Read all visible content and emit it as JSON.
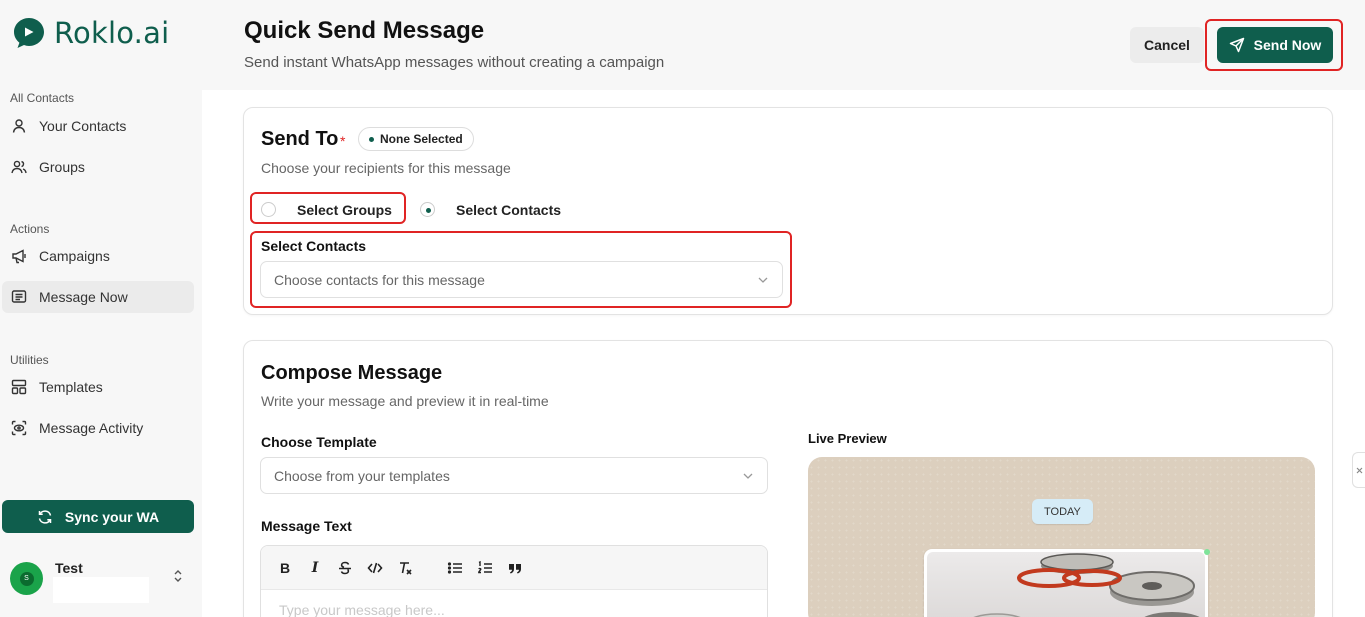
{
  "brand": {
    "name": "Roklo.ai",
    "color": "#0f5e4d"
  },
  "sidebar": {
    "sections": [
      {
        "title": "All Contacts",
        "items": [
          {
            "label": "Your Contacts",
            "icon": "user-icon"
          },
          {
            "label": "Groups",
            "icon": "users-icon"
          }
        ]
      },
      {
        "title": "Actions",
        "items": [
          {
            "label": "Campaigns",
            "icon": "megaphone-icon"
          },
          {
            "label": "Message Now",
            "icon": "message-square-icon",
            "active": true
          }
        ]
      },
      {
        "title": "Utilities",
        "items": [
          {
            "label": "Templates",
            "icon": "layout-icon"
          },
          {
            "label": "Message Activity",
            "icon": "scan-eye-icon"
          }
        ]
      }
    ],
    "sync_button": "Sync your WA",
    "user": {
      "name": "Test",
      "initial": "S"
    }
  },
  "header": {
    "title": "Quick Send Message",
    "subtitle": "Send instant WhatsApp messages without creating a campaign",
    "cancel": "Cancel",
    "send_now": "Send Now"
  },
  "send_to": {
    "title": "Send To",
    "required": "*",
    "badge": "None Selected",
    "subtitle": "Choose your recipients for this message",
    "options": [
      {
        "label": "Select Groups",
        "checked": false
      },
      {
        "label": "Select Contacts",
        "checked": true
      }
    ],
    "contacts_label": "Select Contacts",
    "contacts_placeholder": "Choose contacts for this message"
  },
  "compose": {
    "title": "Compose Message",
    "subtitle": "Write your message and preview it in real-time",
    "template_label": "Choose Template",
    "template_placeholder": "Choose from your templates",
    "message_label": "Message Text",
    "toolbar": [
      "B",
      "I",
      "S",
      "</>",
      "Tx",
      "list",
      "ordered-list",
      "quote"
    ],
    "message_placeholder": "Type your message here...",
    "preview_label": "Live Preview",
    "preview_day": "TODAY"
  },
  "colors": {
    "accent": "#0f5e4d",
    "highlight": "#e02424",
    "preview_bg": "#dccfbe"
  }
}
